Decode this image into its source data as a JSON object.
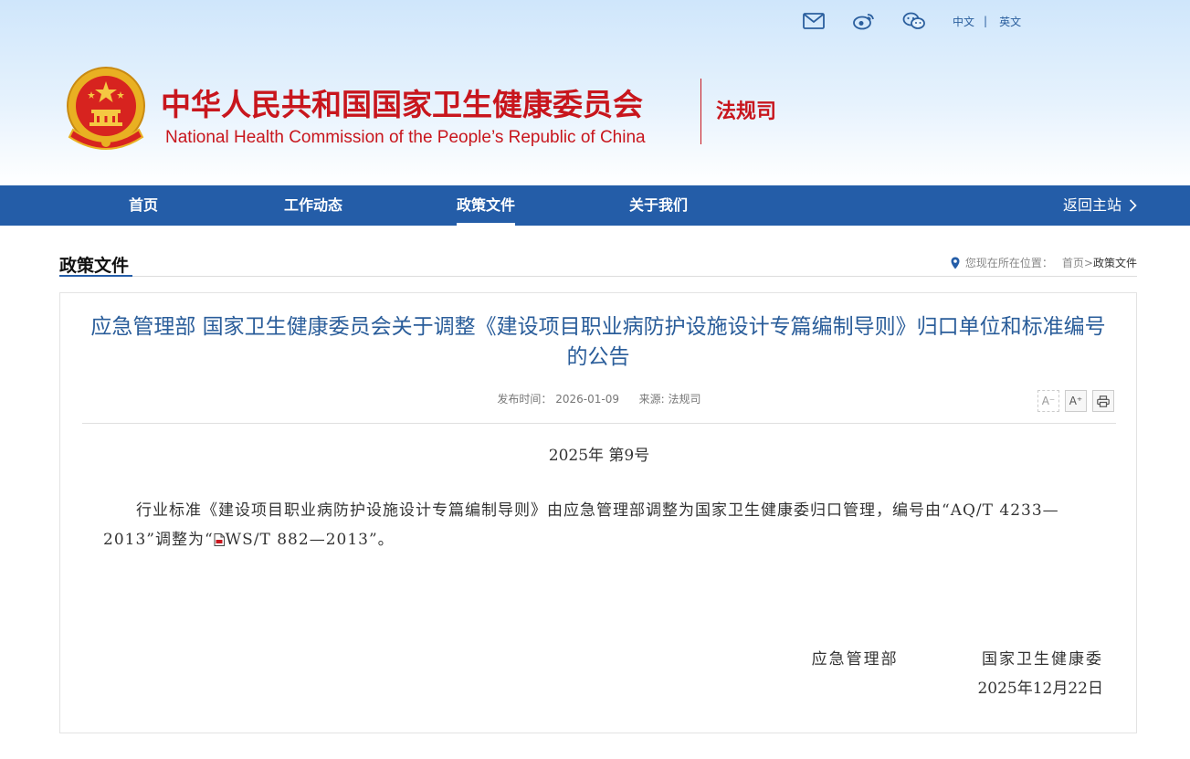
{
  "header": {
    "title_cn": "中华人民共和国国家卫生健康委员会",
    "title_en": "National Health Commission of the People’s  Republic of China",
    "department": "法规司",
    "lang_cn": "中文",
    "lang_sep": "|",
    "lang_en": "英文",
    "icons": [
      "mail-icon",
      "weibo-icon",
      "wechat-icon"
    ]
  },
  "nav": {
    "items": [
      {
        "label": "首页"
      },
      {
        "label": "工作动态"
      },
      {
        "label": "政策文件"
      },
      {
        "label": "关于我们"
      }
    ],
    "active": "政策文件",
    "back_label": "返回主站"
  },
  "section": {
    "title": "政策文件",
    "breadcrumb_prefix": "您现在所在位置：",
    "breadcrumb_home": "首页",
    "breadcrumb_sep": ">",
    "breadcrumb_current": "政策文件"
  },
  "article": {
    "title": "应急管理部 国家卫生健康委员会关于调整《建设项目职业病防护设施设计专篇编制导则》归口单位和标准编号的公告",
    "publish_label": "发布时间：",
    "publish_date": "2026-01-09",
    "source_label": "来源:",
    "source": "法规司",
    "font_tools": [
      "A⁻",
      "A⁺",
      "print"
    ],
    "doc_number": "2025年  第9号",
    "paragraph_before": "行业标准《建设项目职业病防护设施设计专篇编制导则》由应急管理部调整为国家卫生健康委归口管理，编号由“AQ/T 4233—2013”调整为“",
    "attachment_text": "WS/T 882—2013",
    "paragraph_after": "”。",
    "signer_1": "应急管理部",
    "signer_2": "国家卫生健康委",
    "sign_date": "2025年12月22日"
  },
  "colors": {
    "brand_red": "#c8161d",
    "nav_blue": "#245da8",
    "title_blue": "#2a5d9a"
  }
}
